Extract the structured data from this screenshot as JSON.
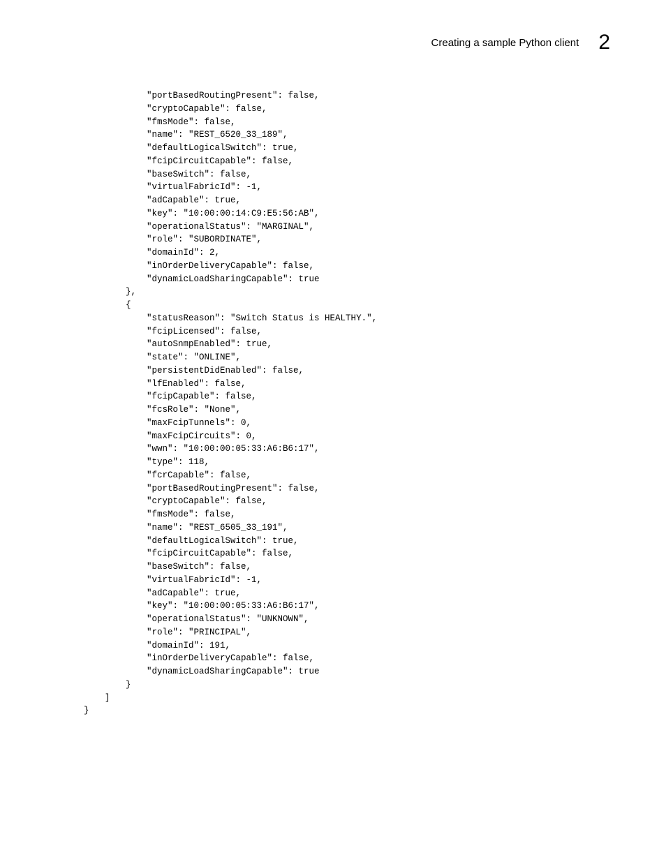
{
  "header": {
    "title": "Creating a sample Python client",
    "chapterNumber": "2"
  },
  "code": "            \"portBasedRoutingPresent\": false,\n            \"cryptoCapable\": false,\n            \"fmsMode\": false,\n            \"name\": \"REST_6520_33_189\",\n            \"defaultLogicalSwitch\": true,\n            \"fcipCircuitCapable\": false,\n            \"baseSwitch\": false,\n            \"virtualFabricId\": -1,\n            \"adCapable\": true,\n            \"key\": \"10:00:00:14:C9:E5:56:AB\",\n            \"operationalStatus\": \"MARGINAL\",\n            \"role\": \"SUBORDINATE\",\n            \"domainId\": 2,\n            \"inOrderDeliveryCapable\": false,\n            \"dynamicLoadSharingCapable\": true\n        },\n        {\n            \"statusReason\": \"Switch Status is HEALTHY.\",\n            \"fcipLicensed\": false,\n            \"autoSnmpEnabled\": true,\n            \"state\": \"ONLINE\",\n            \"persistentDidEnabled\": false,\n            \"lfEnabled\": false,\n            \"fcipCapable\": false,\n            \"fcsRole\": \"None\",\n            \"maxFcipTunnels\": 0,\n            \"maxFcipCircuits\": 0,\n            \"wwn\": \"10:00:00:05:33:A6:B6:17\",\n            \"type\": 118,\n            \"fcrCapable\": false,\n            \"portBasedRoutingPresent\": false,\n            \"cryptoCapable\": false,\n            \"fmsMode\": false,\n            \"name\": \"REST_6505_33_191\",\n            \"defaultLogicalSwitch\": true,\n            \"fcipCircuitCapable\": false,\n            \"baseSwitch\": false,\n            \"virtualFabricId\": -1,\n            \"adCapable\": true,\n            \"key\": \"10:00:00:05:33:A6:B6:17\",\n            \"operationalStatus\": \"UNKNOWN\",\n            \"role\": \"PRINCIPAL\",\n            \"domainId\": 191,\n            \"inOrderDeliveryCapable\": false,\n            \"dynamicLoadSharingCapable\": true\n        }\n    ]\n}"
}
